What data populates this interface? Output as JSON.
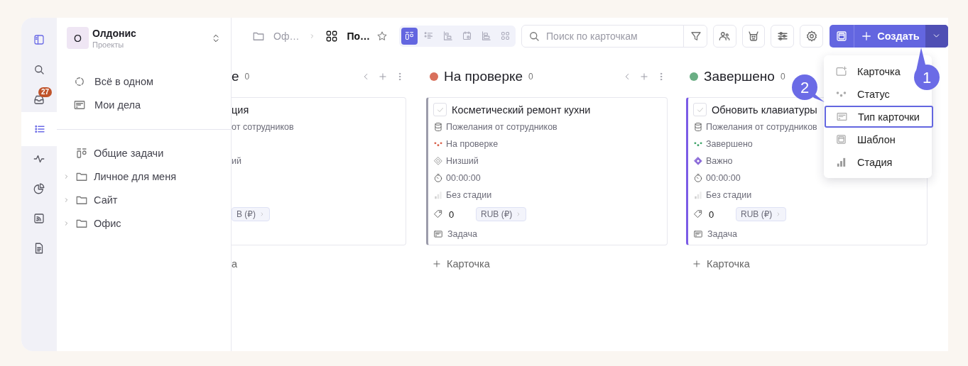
{
  "rail": {
    "items": [
      {
        "kind": "panel",
        "selected": false
      },
      {
        "kind": "search",
        "selected": false
      },
      {
        "kind": "inbox",
        "selected": false,
        "badge": "27"
      },
      {
        "kind": "list",
        "selected": true
      },
      {
        "kind": "activity",
        "selected": false
      },
      {
        "kind": "pie",
        "selected": false
      },
      {
        "kind": "feed",
        "selected": false
      },
      {
        "kind": "document",
        "selected": false
      }
    ]
  },
  "sidebar": {
    "workspace": {
      "initial": "О",
      "name": "Олдонис",
      "subtitle": "Проекты"
    },
    "items": [
      {
        "kind": "all",
        "label": "Всё в одном"
      },
      {
        "kind": "tasks",
        "label": "Мои дела"
      }
    ],
    "tree": [
      {
        "kind": "board",
        "label": "Общие задачи"
      },
      {
        "kind": "folder",
        "label": "Личное для меня",
        "expanded": false
      },
      {
        "kind": "folder",
        "label": "Сайт",
        "expanded": false
      },
      {
        "kind": "folder",
        "label": "Офис",
        "expanded": false
      }
    ]
  },
  "breadcrumb": [
    {
      "kind": "folder",
      "label": "Оф…"
    },
    {
      "kind": "board",
      "label": "По…",
      "starred": false
    }
  ],
  "view_switcher": [
    {
      "kind": "kanban",
      "selected": true
    },
    {
      "kind": "list",
      "selected": false
    },
    {
      "kind": "gantt",
      "selected": false
    },
    {
      "kind": "calendar",
      "selected": false
    },
    {
      "kind": "timeline",
      "selected": false
    },
    {
      "kind": "grid",
      "selected": false
    }
  ],
  "search": {
    "placeholder": "Поиск по карточкам"
  },
  "toolbar_buttons": [
    {
      "kind": "people"
    },
    {
      "kind": "bot"
    },
    {
      "kind": "sliders"
    },
    {
      "kind": "settings"
    }
  ],
  "create_button": {
    "label": "Создать"
  },
  "create_menu": {
    "items": [
      {
        "kind": "card",
        "label": "Карточка",
        "selected": false
      },
      {
        "kind": "status",
        "label": "Статус",
        "selected": false
      },
      {
        "kind": "card_type",
        "label": "Тип карточки",
        "selected": true
      },
      {
        "kind": "template",
        "label": "Шаблон",
        "selected": false
      },
      {
        "kind": "stage",
        "label": "Стадия",
        "selected": false
      }
    ]
  },
  "callouts": [
    {
      "number": "1"
    },
    {
      "number": "2"
    }
  ],
  "columns": [
    {
      "kind": "clipped",
      "title": "е",
      "count": "0",
      "show_controls": true,
      "add_label": "а",
      "cards": [
        {
          "title": "ция",
          "project": "от сотрудников",
          "priority": {
            "label": "ий"
          },
          "currency": "B (₽)"
        }
      ]
    },
    {
      "kind": "full",
      "title": "На проверке",
      "count": "0",
      "color": "#d9705c",
      "show_controls": true,
      "add_label": "Карточка",
      "cards": [
        {
          "color": "#9c9cab",
          "checked": false,
          "title": "Косметический ремонт кухни",
          "project": "Пожелания от сотрудников",
          "status": {
            "label": "На проверке",
            "color": "#d9624c"
          },
          "priority": {
            "kind": "low",
            "label": "Низший"
          },
          "time": "00:00:00",
          "stage": "Без стадии",
          "amount": "0",
          "currency": "RUB (₽)",
          "type": "Задача"
        }
      ]
    },
    {
      "kind": "full",
      "title": "Завершено",
      "count": "0",
      "color": "#6aae84",
      "show_controls": false,
      "add_label": "Карточка",
      "cards": [
        {
          "color": "#7b5ce6",
          "checked": false,
          "title": "Обновить клавиатуры",
          "project": "Пожелания от сотрудников",
          "status": {
            "label": "Завершено",
            "color": "#3fa46a"
          },
          "priority": {
            "kind": "important",
            "label": "Важно"
          },
          "time": "00:00:00",
          "stage": "Без стадии",
          "amount": "0",
          "currency": "RUB (₽)",
          "type": "Задача"
        }
      ]
    }
  ]
}
